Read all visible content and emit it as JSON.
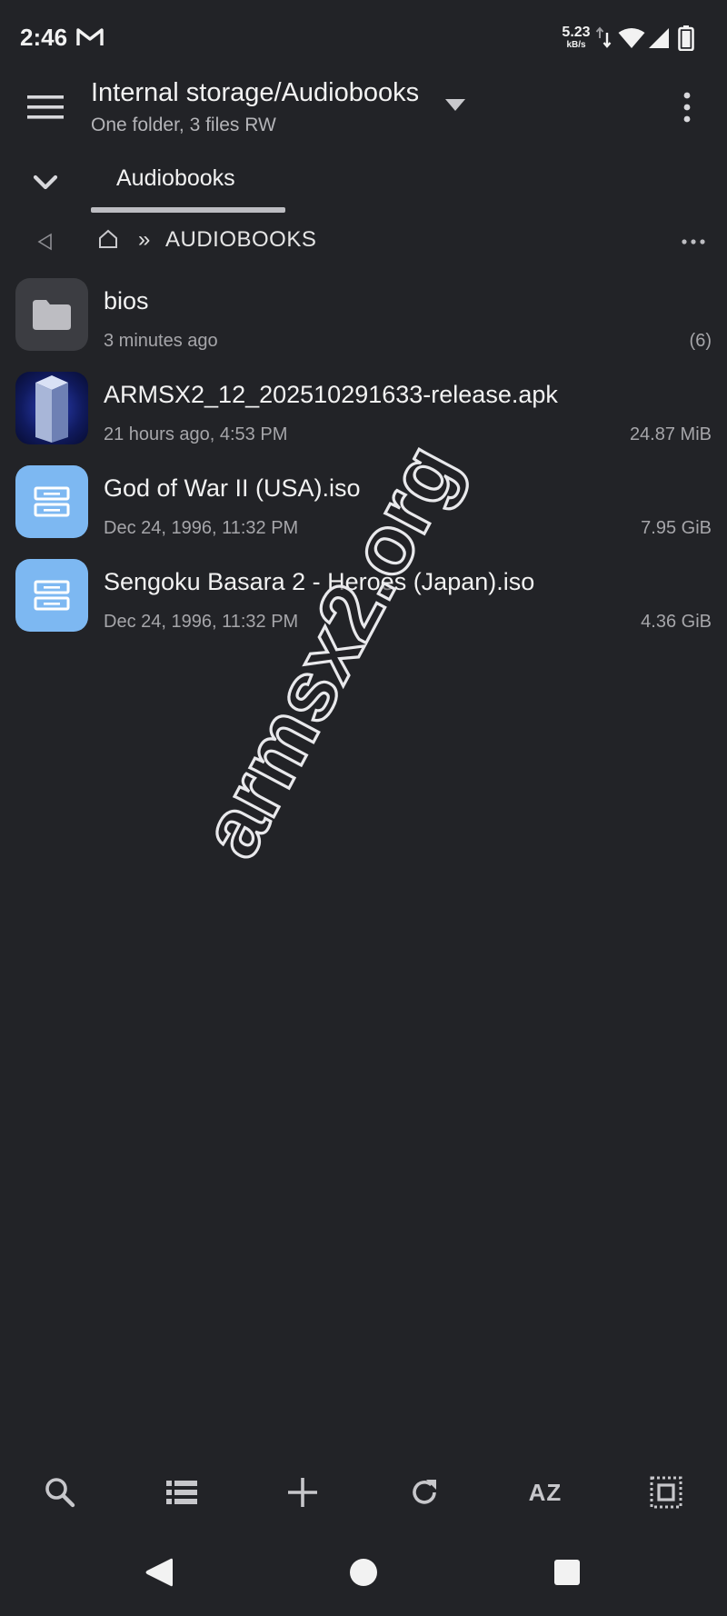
{
  "status_bar": {
    "time": "2:46",
    "net_speed": "5.23",
    "net_speed_unit": "kB/s"
  },
  "app_bar": {
    "path_title": "Internal storage/Audiobooks",
    "path_subtitle": "One folder, 3 files RW"
  },
  "tabs": [
    {
      "label": "Audiobooks"
    }
  ],
  "breadcrumb": {
    "separator": "»",
    "current": "AUDIOBOOKS"
  },
  "files": [
    {
      "name": "bios",
      "meta": "3 minutes ago",
      "size": "(6)",
      "icon": "folder-icon"
    },
    {
      "name": "ARMSX2_12_202510291633-release.apk",
      "meta": "21 hours ago, 4:53 PM",
      "size": "24.87 MiB",
      "icon": "apk-app-icon"
    },
    {
      "name": "God of War II (USA).iso",
      "meta": "Dec 24, 1996, 11:32 PM",
      "size": "7.95 GiB",
      "icon": "disc-image-icon"
    },
    {
      "name": "Sengoku Basara 2 - Heroes (Japan).iso",
      "meta": "Dec 24, 1996, 11:32 PM",
      "size": "4.36 GiB",
      "icon": "disc-image-icon"
    }
  ],
  "watermark": "armsx2.org",
  "toolbar": {
    "sort_label": "AZ",
    "icons": [
      "search-icon",
      "list-view-icon",
      "add-icon",
      "refresh-icon",
      "sort-icon",
      "select-all-icon"
    ]
  },
  "colors": {
    "background": "#222327",
    "iso_icon": "#7DB8F2",
    "folder_icon_bg": "#3C3D42",
    "text_primary": "#F2F2F2",
    "text_secondary": "#A6A6AA"
  }
}
